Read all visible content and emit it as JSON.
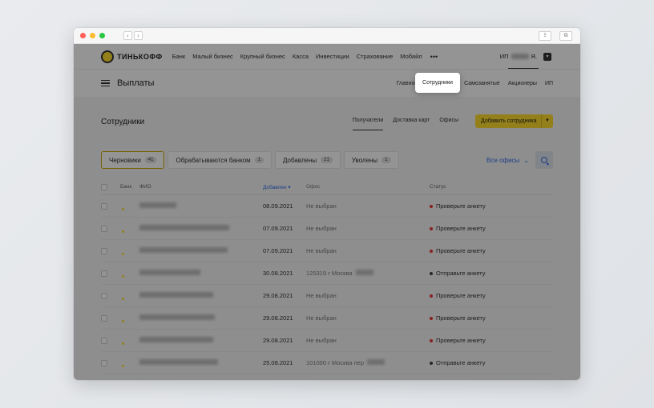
{
  "browser": {
    "back": "‹",
    "forward": "›",
    "share": "⇪",
    "tabs": "⧉"
  },
  "header": {
    "brand": "ТИНЬКОФФ",
    "nav": [
      "Банк",
      "Малый бизнес",
      "Крупный бизнес",
      "Касса",
      "Инвестиции",
      "Страхование",
      "Мобайл"
    ],
    "more": "•••",
    "account_prefix": "ИП",
    "account_suffix": "Я."
  },
  "subnav": {
    "title": "Выплаты",
    "tabs": [
      "Главное",
      "Сотрудники",
      "Самозанятые",
      "Акционеры",
      "ИП"
    ],
    "highlighted": "Сотрудники"
  },
  "section": {
    "title": "Сотрудники",
    "tabs": [
      "Получатели",
      "Доставка карт",
      "Офисы"
    ],
    "add_button": "Добавить сотрудника"
  },
  "filters": [
    {
      "label": "Черновики",
      "count": "41"
    },
    {
      "label": "Обрабатываются банком",
      "count": "1"
    },
    {
      "label": "Добавлены",
      "count": "21"
    },
    {
      "label": "Уволены",
      "count": "1"
    }
  ],
  "offices_filter": "Все офисы",
  "table": {
    "columns": {
      "bank": "Банк",
      "name": "ФИО",
      "date": "Добавлен",
      "office": "Офис",
      "status": "Статус"
    },
    "rows": [
      {
        "date": "08.09.2021",
        "office": "Не выбран",
        "status": "Проверьте анкету",
        "status_color": "#e53935"
      },
      {
        "date": "07.09.2021",
        "office": "Не выбран",
        "status": "Проверьте анкету",
        "status_color": "#e53935"
      },
      {
        "date": "07.09.2021",
        "office": "Не выбран",
        "status": "Проверьте анкету",
        "status_color": "#e53935"
      },
      {
        "date": "30.08.2021",
        "office": "125319 г Москва",
        "status": "Отправьте анкету",
        "status_color": "#444444"
      },
      {
        "date": "29.08.2021",
        "office": "Не выбран",
        "status": "Проверьте анкету",
        "status_color": "#e53935"
      },
      {
        "date": "29.08.2021",
        "office": "Не выбран",
        "status": "Проверьте анкету",
        "status_color": "#e53935"
      },
      {
        "date": "29.08.2021",
        "office": "Не выбран",
        "status": "Проверьте анкету",
        "status_color": "#e53935"
      },
      {
        "date": "25.08.2021",
        "office": "101000 г Москва пер",
        "status": "Отправьте анкету",
        "status_color": "#444444"
      }
    ]
  },
  "colors": {
    "accent": "#ffdd2d",
    "link": "#336fee"
  }
}
